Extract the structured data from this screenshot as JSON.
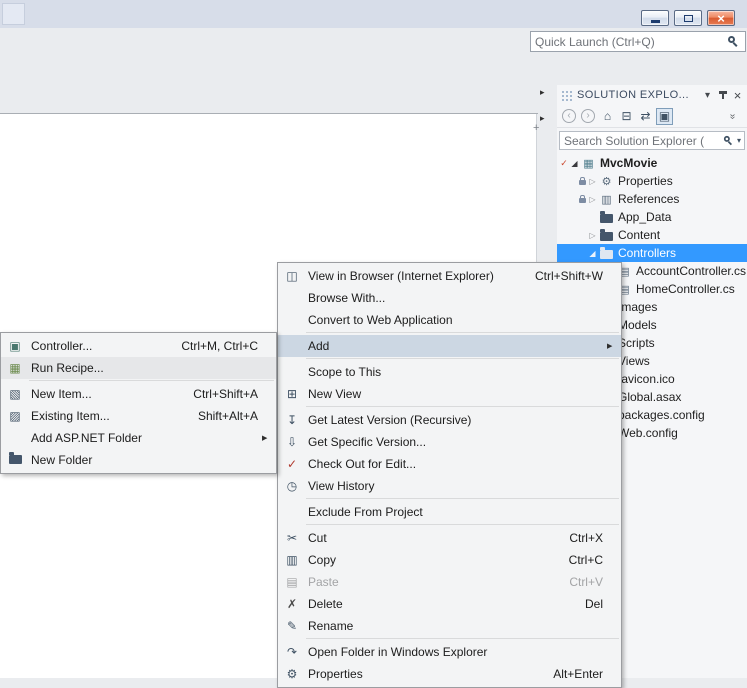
{
  "colors": {
    "selection_blue": "#3399ff",
    "menu_highlight": "#ccd7e3",
    "close_button_red": "#d95b31"
  },
  "window": {
    "controls": [
      {
        "name": "minimize-button"
      },
      {
        "name": "maximize-button"
      },
      {
        "name": "close-button"
      }
    ],
    "quick_launch": {
      "placeholder": "Quick Launch (Ctrl+Q)"
    }
  },
  "solution_explorer": {
    "title": "SOLUTION EXPLO...",
    "toolbar": [
      {
        "name": "back-icon",
        "disabled": true
      },
      {
        "name": "forward-icon",
        "disabled": true
      },
      {
        "name": "home-icon"
      },
      {
        "name": "collapse-all-icon"
      },
      {
        "name": "sync-with-active-document-icon"
      },
      {
        "name": "preview-selected-items-icon",
        "pressed": true
      },
      {
        "name": "toolbar-overflow-icon",
        "overflow": true
      }
    ],
    "search": {
      "placeholder": "Search Solution Explorer ("
    },
    "tree": [
      {
        "label": "MvcMovie",
        "depth": 0,
        "icon": "csharp-project-icon",
        "expander": "expanded",
        "status": "check",
        "bold": true
      },
      {
        "label": "Properties",
        "depth": 1,
        "icon": "wrench-icon",
        "expander": "collapsed",
        "status": "lock"
      },
      {
        "label": "References",
        "depth": 1,
        "icon": "references-icon",
        "expander": "collapsed",
        "status": "lock"
      },
      {
        "label": "App_Data",
        "depth": 1,
        "icon": "folder-icon"
      },
      {
        "label": "Content",
        "depth": 1,
        "icon": "folder-icon",
        "expander": "collapsed"
      },
      {
        "label": "Controllers",
        "depth": 1,
        "icon": "folder-open-icon",
        "expander": "expanded",
        "selected": true
      },
      {
        "label": "AccountController.cs",
        "depth": 2,
        "icon": "csharp-file-icon"
      },
      {
        "label": "HomeController.cs",
        "depth": 2,
        "icon": "csharp-file-icon"
      },
      {
        "label": "Images",
        "depth": 1,
        "icon": "folder-icon",
        "expander": "collapsed"
      },
      {
        "label": "Models",
        "depth": 1,
        "icon": "folder-icon",
        "expander": "collapsed"
      },
      {
        "label": "Scripts",
        "depth": 1,
        "icon": "folder-icon",
        "expander": "collapsed"
      },
      {
        "label": "Views",
        "depth": 1,
        "icon": "folder-icon",
        "expander": "collapsed"
      },
      {
        "label": "favicon.ico",
        "depth": 1,
        "icon": "file-icon"
      },
      {
        "label": "Global.asax",
        "depth": 1,
        "icon": "file-icon"
      },
      {
        "label": "packages.config",
        "depth": 1,
        "icon": "file-icon"
      },
      {
        "label": "Web.config",
        "depth": 1,
        "icon": "file-icon"
      }
    ]
  },
  "context_menu": {
    "items": [
      {
        "label": "View in Browser (Internet Explorer)",
        "shortcut": "Ctrl+Shift+W",
        "icon": "browser-window-icon"
      },
      {
        "label": "Browse With..."
      },
      {
        "label": "Convert to Web Application"
      },
      {
        "type": "separator"
      },
      {
        "label": "Add",
        "submenu": true,
        "highlighted": true
      },
      {
        "type": "separator"
      },
      {
        "label": "Scope to This"
      },
      {
        "label": "New View",
        "icon": "new-view-icon"
      },
      {
        "type": "separator"
      },
      {
        "label": "Get Latest Version (Recursive)",
        "icon": "get-latest-version-icon"
      },
      {
        "label": "Get Specific Version...",
        "icon": "get-specific-version-icon"
      },
      {
        "label": "Check Out for Edit...",
        "icon": "check-out-icon"
      },
      {
        "label": "View History",
        "icon": "view-history-icon"
      },
      {
        "type": "separator"
      },
      {
        "label": "Exclude From Project"
      },
      {
        "type": "separator"
      },
      {
        "label": "Cut",
        "shortcut": "Ctrl+X",
        "icon": "cut-icon"
      },
      {
        "label": "Copy",
        "shortcut": "Ctrl+C",
        "icon": "copy-icon"
      },
      {
        "label": "Paste",
        "shortcut": "Ctrl+V",
        "icon": "paste-icon",
        "disabled": true
      },
      {
        "label": "Delete",
        "shortcut": "Del",
        "icon": "delete-icon"
      },
      {
        "label": "Rename",
        "icon": "rename-icon"
      },
      {
        "type": "separator"
      },
      {
        "label": "Open Folder in Windows Explorer",
        "icon": "open-folder-icon"
      },
      {
        "label": "Properties",
        "shortcut": "Alt+Enter",
        "icon": "properties-icon"
      }
    ]
  },
  "add_submenu": {
    "items": [
      {
        "label": "Controller...",
        "shortcut": "Ctrl+M, Ctrl+C",
        "icon": "controller-icon"
      },
      {
        "label": "Run Recipe...",
        "icon": "run-recipe-icon",
        "hovered": true
      },
      {
        "type": "separator"
      },
      {
        "label": "New Item...",
        "shortcut": "Ctrl+Shift+A",
        "icon": "new-item-icon"
      },
      {
        "label": "Existing Item...",
        "shortcut": "Shift+Alt+A",
        "icon": "existing-item-icon"
      },
      {
        "label": "Add ASP.NET Folder",
        "submenu": true
      },
      {
        "label": "New Folder",
        "icon": "new-folder-icon"
      }
    ]
  }
}
